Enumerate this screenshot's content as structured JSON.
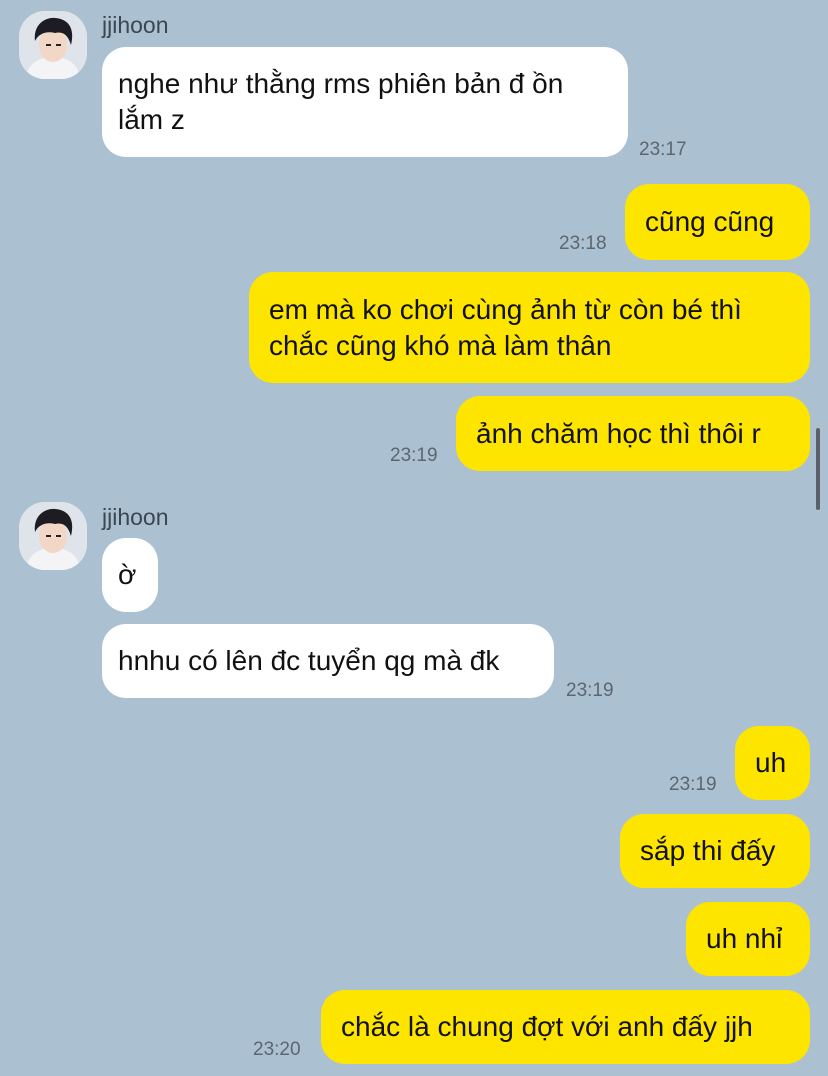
{
  "chat": {
    "groups": [
      {
        "sender": "jjihoon",
        "messages": [
          {
            "text": "nghe như thằng rms phiên bản đ ồn\nlắm z",
            "time": "23:17"
          }
        ]
      },
      {
        "sender": "me",
        "messages": [
          {
            "text": "cũng cũng",
            "time": "23:18"
          },
          {
            "text": "em mà ko chơi cùng ảnh từ còn bé thì\nchắc cũng khó mà làm thân",
            "time": ""
          },
          {
            "text": "ảnh chăm học thì thôi r",
            "time": "23:19"
          }
        ]
      },
      {
        "sender": "jjihoon",
        "messages": [
          {
            "text": "ờ",
            "time": ""
          },
          {
            "text": "hnhu có lên đc tuyển qg mà đk",
            "time": "23:19"
          }
        ]
      },
      {
        "sender": "me",
        "messages": [
          {
            "text": "uh",
            "time": "23:19"
          },
          {
            "text": "sắp thi đấy",
            "time": ""
          },
          {
            "text": "uh nhỉ",
            "time": ""
          },
          {
            "text": "chắc là chung đợt với anh đấy jjh",
            "time": "23:20"
          }
        ]
      }
    ]
  },
  "colors": {
    "background": "#abc1d1",
    "outgoing_bubble": "#fee500",
    "incoming_bubble": "#ffffff"
  },
  "icons": {
    "avatar": "profile-photo"
  }
}
